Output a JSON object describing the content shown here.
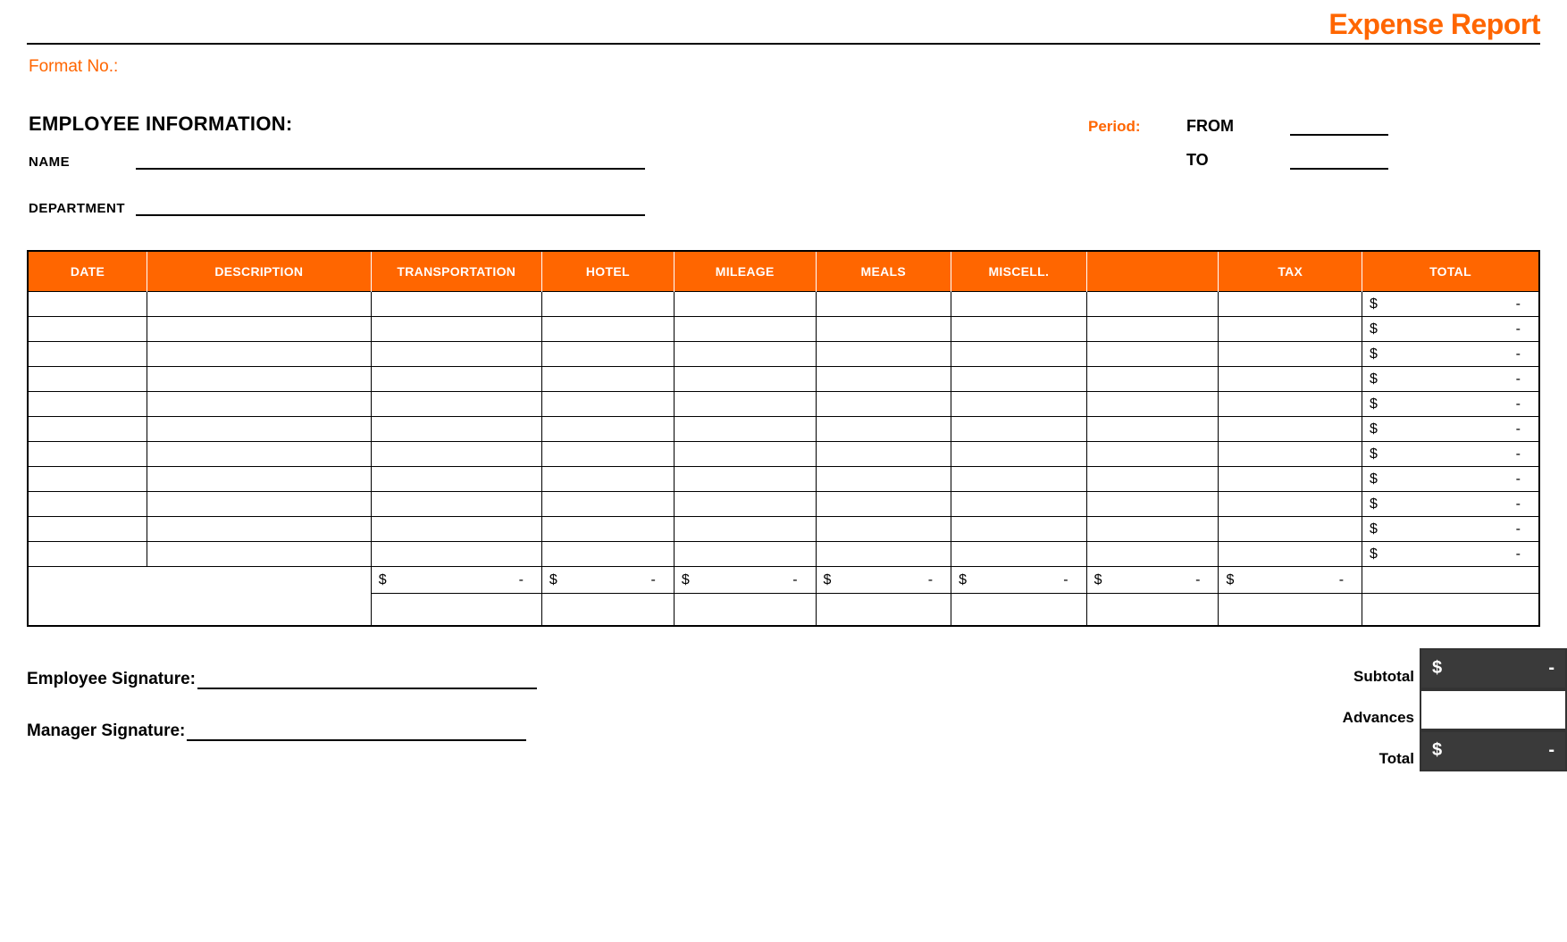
{
  "title": "Expense Report",
  "format_no_label": "Format No.:",
  "employee_info": {
    "header": "EMPLOYEE INFORMATION:",
    "name_label": "NAME",
    "department_label": "DEPARTMENT",
    "period_label": "Period:",
    "from_label": "FROM",
    "to_label": "TO"
  },
  "table": {
    "headers": {
      "date": "DATE",
      "description": "DESCRIPTION",
      "transportation": "TRANSPORTATION",
      "hotel": "HOTEL",
      "mileage": "MILEAGE",
      "meals": "MEALS",
      "miscell": "MISCELL.",
      "blank": "",
      "tax": "TAX",
      "total": "TOTAL"
    },
    "currency": "$",
    "dash": "-",
    "row_count": 11
  },
  "signatures": {
    "employee": "Employee Signature:",
    "manager": "Manager Signature:"
  },
  "summary": {
    "subtotal_label": "Subtotal",
    "advances_label": "Advances",
    "total_label": "Total",
    "currency": "$",
    "dash": "-"
  }
}
